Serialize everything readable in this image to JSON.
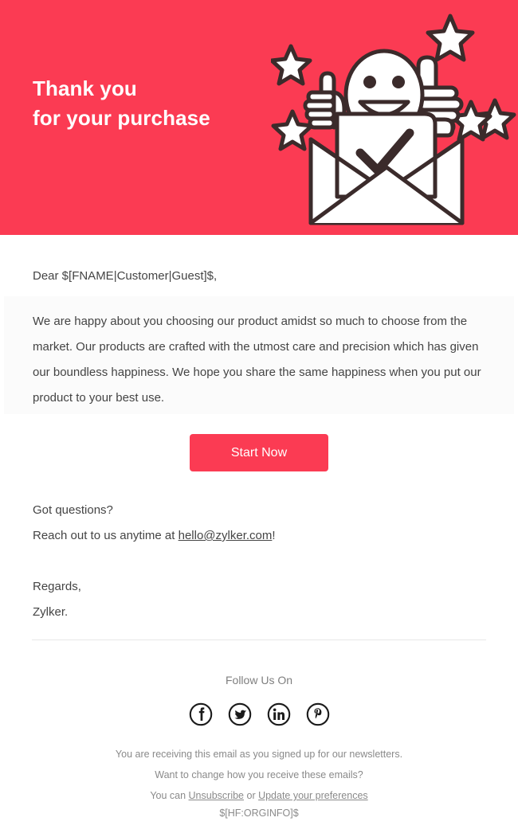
{
  "colors": {
    "brand_red": "#FB3B53",
    "body_text": "#444444",
    "muted_text": "#8A8A8A",
    "panel_bg": "#FBFBFB",
    "divider": "#E8E8E8",
    "illustration_stroke": "#3B2B2B"
  },
  "hero": {
    "title_line1": "Thank you",
    "title_line2": "for your purchase",
    "illustration_name": "thank-you-illustration"
  },
  "body": {
    "salutation": "Dear $[FNAME|Customer|Guest]$,",
    "paragraph": "We are happy about you choosing our product amidst so much to choose from the market. Our products are crafted with the utmost care and precision which has given our boundless happiness. We hope you share the same happiness when you put our product to your best use."
  },
  "cta": {
    "label": "Start Now"
  },
  "contact": {
    "question_line": "Got questions?",
    "reach_prefix": "Reach out to us anytime at ",
    "email": "hello@zylker.com",
    "reach_suffix": "!"
  },
  "signoff": {
    "regards": "Regards,",
    "sender": "Zylker."
  },
  "footer": {
    "follow_label": "Follow Us On",
    "social": [
      {
        "name": "facebook-icon",
        "glyph": "f"
      },
      {
        "name": "twitter-icon",
        "glyph": "twitter"
      },
      {
        "name": "linkedin-icon",
        "glyph": "in"
      },
      {
        "name": "pinterest-icon",
        "glyph": "p"
      }
    ],
    "legal_line1": "You are receiving this email as you signed up for our newsletters.",
    "legal_line2": "Want to change how you receive these emails?",
    "legal_line3_prefix": "You can ",
    "unsubscribe_label": "Unsubscribe",
    "legal_line3_middle": " or ",
    "preferences_label": "Update your preferences",
    "orginfo": "$[HF:ORGINFO]$"
  }
}
